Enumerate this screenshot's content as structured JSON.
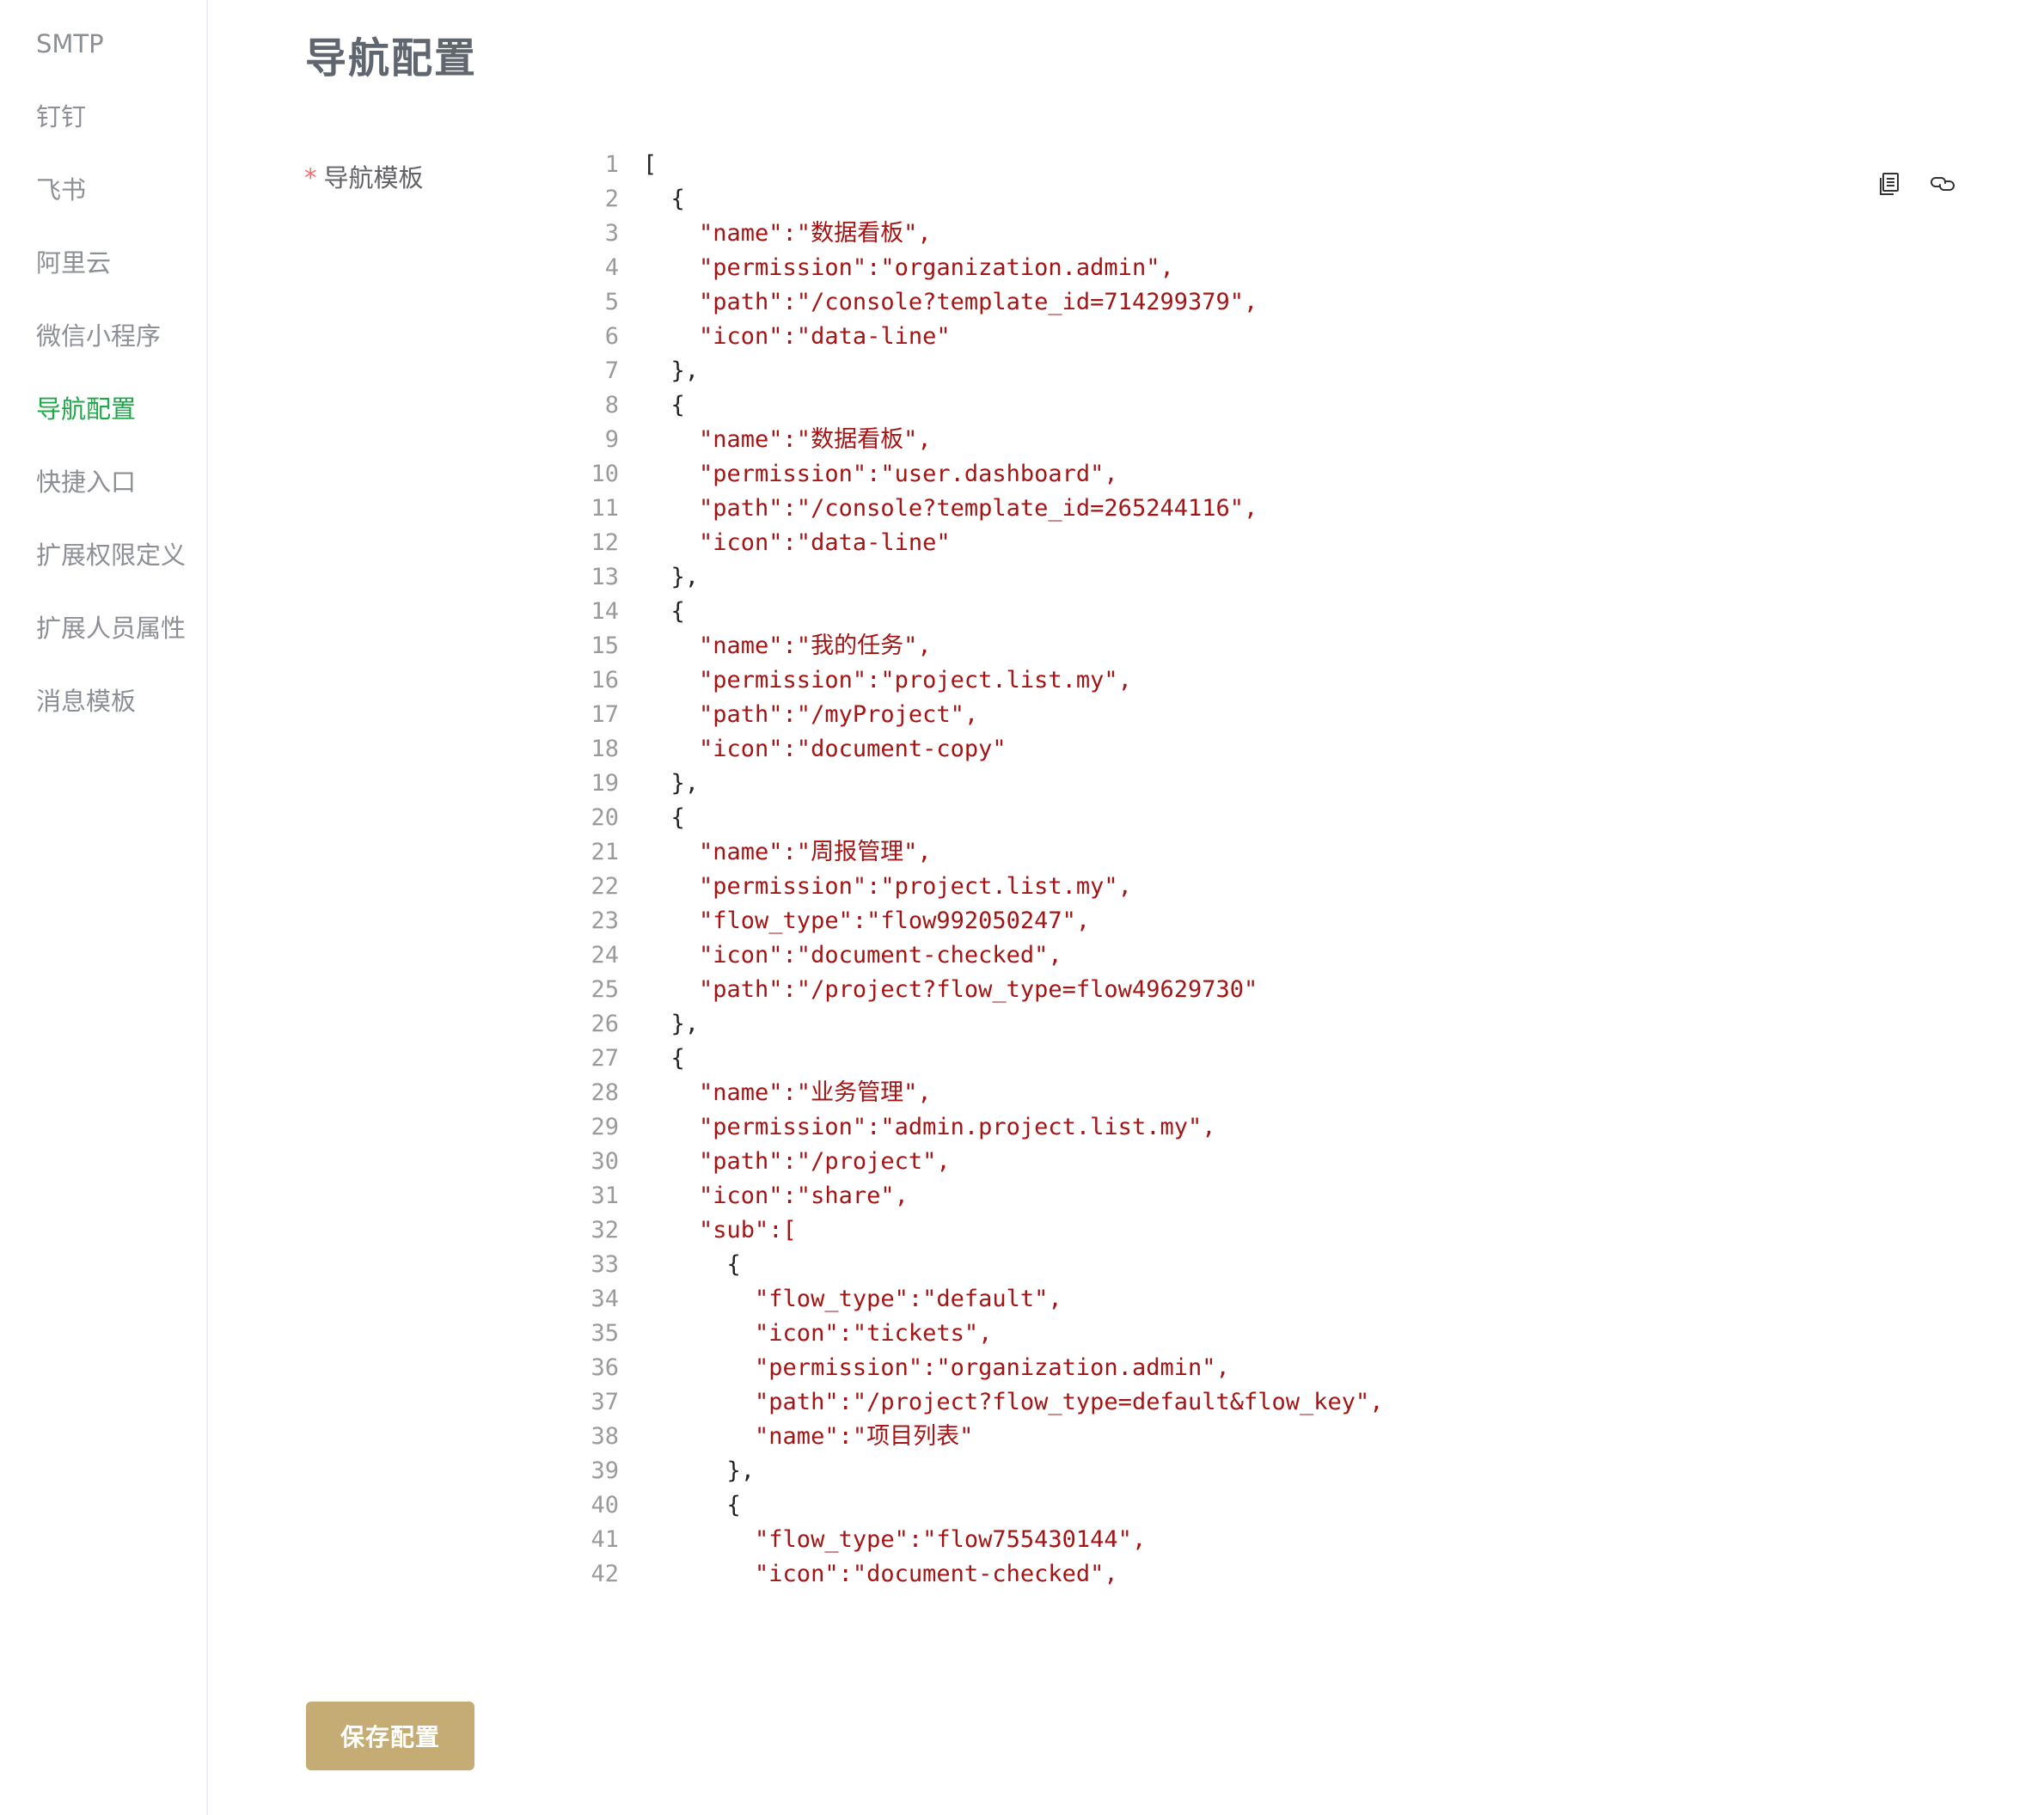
{
  "sidebar": {
    "items": [
      {
        "label": "SMTP",
        "active": false
      },
      {
        "label": "钉钉",
        "active": false
      },
      {
        "label": "飞书",
        "active": false
      },
      {
        "label": "阿里云",
        "active": false
      },
      {
        "label": "微信小程序",
        "active": false
      },
      {
        "label": "导航配置",
        "active": true
      },
      {
        "label": "快捷入口",
        "active": false
      },
      {
        "label": "扩展权限定义",
        "active": false
      },
      {
        "label": "扩展人员属性",
        "active": false
      },
      {
        "label": "消息模板",
        "active": false
      }
    ]
  },
  "main": {
    "title": "导航配置",
    "field_label": "导航模板",
    "required_mark": "*",
    "save_label": "保存配置"
  },
  "editor": {
    "toolbar": {
      "copy_icon": "copy-icon",
      "link_icon": "link-icon"
    },
    "lines": [
      {
        "n": "1",
        "text": "["
      },
      {
        "n": "2",
        "text": "  {"
      },
      {
        "n": "3",
        "text": "    \"name\":\"数据看板\","
      },
      {
        "n": "4",
        "text": "    \"permission\":\"organization.admin\","
      },
      {
        "n": "5",
        "text": "    \"path\":\"/console?template_id=714299379\","
      },
      {
        "n": "6",
        "text": "    \"icon\":\"data-line\""
      },
      {
        "n": "7",
        "text": "  },"
      },
      {
        "n": "8",
        "text": "  {"
      },
      {
        "n": "9",
        "text": "    \"name\":\"数据看板\","
      },
      {
        "n": "10",
        "text": "    \"permission\":\"user.dashboard\","
      },
      {
        "n": "11",
        "text": "    \"path\":\"/console?template_id=265244116\","
      },
      {
        "n": "12",
        "text": "    \"icon\":\"data-line\""
      },
      {
        "n": "13",
        "text": "  },"
      },
      {
        "n": "14",
        "text": "  {"
      },
      {
        "n": "15",
        "text": "    \"name\":\"我的任务\","
      },
      {
        "n": "16",
        "text": "    \"permission\":\"project.list.my\","
      },
      {
        "n": "17",
        "text": "    \"path\":\"/myProject\","
      },
      {
        "n": "18",
        "text": "    \"icon\":\"document-copy\""
      },
      {
        "n": "19",
        "text": "  },"
      },
      {
        "n": "20",
        "text": "  {"
      },
      {
        "n": "21",
        "text": "    \"name\":\"周报管理\","
      },
      {
        "n": "22",
        "text": "    \"permission\":\"project.list.my\","
      },
      {
        "n": "23",
        "text": "    \"flow_type\":\"flow992050247\","
      },
      {
        "n": "24",
        "text": "    \"icon\":\"document-checked\","
      },
      {
        "n": "25",
        "text": "    \"path\":\"/project?flow_type=flow49629730\""
      },
      {
        "n": "26",
        "text": "  },"
      },
      {
        "n": "27",
        "text": "  {"
      },
      {
        "n": "28",
        "text": "    \"name\":\"业务管理\","
      },
      {
        "n": "29",
        "text": "    \"permission\":\"admin.project.list.my\","
      },
      {
        "n": "30",
        "text": "    \"path\":\"/project\","
      },
      {
        "n": "31",
        "text": "    \"icon\":\"share\","
      },
      {
        "n": "32",
        "text": "    \"sub\":["
      },
      {
        "n": "33",
        "text": "      {"
      },
      {
        "n": "34",
        "text": "        \"flow_type\":\"default\","
      },
      {
        "n": "35",
        "text": "        \"icon\":\"tickets\","
      },
      {
        "n": "36",
        "text": "        \"permission\":\"organization.admin\","
      },
      {
        "n": "37",
        "text": "        \"path\":\"/project?flow_type=default&flow_key\","
      },
      {
        "n": "38",
        "text": "        \"name\":\"项目列表\""
      },
      {
        "n": "39",
        "text": "      },"
      },
      {
        "n": "40",
        "text": "      {"
      },
      {
        "n": "41",
        "text": "        \"flow_type\":\"flow755430144\","
      },
      {
        "n": "42",
        "text": "        \"icon\":\"document-checked\","
      }
    ]
  }
}
